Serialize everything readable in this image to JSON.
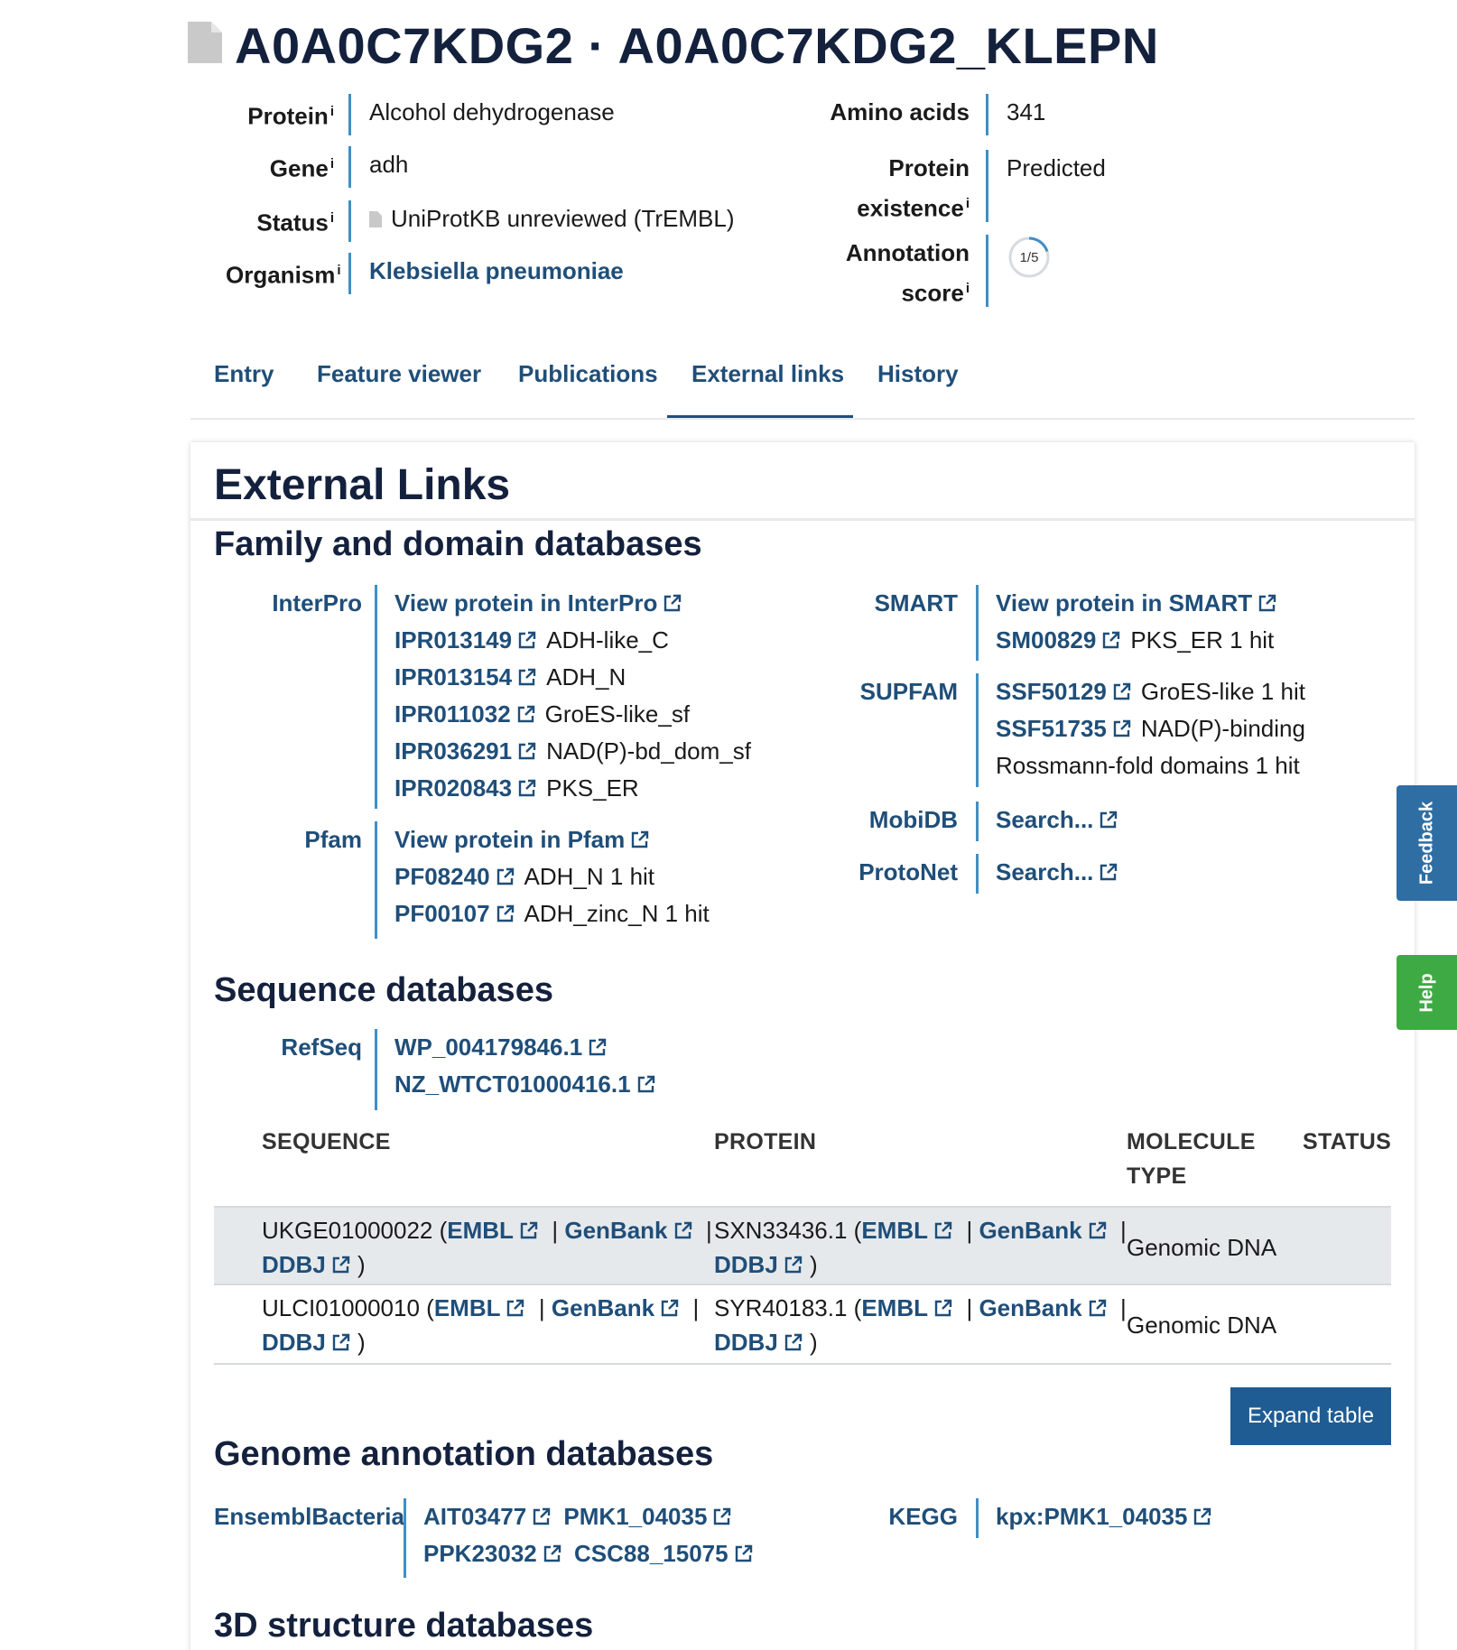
{
  "header": {
    "title": "A0A0C7KDG2 · A0A0C7KDG2_KLEPN"
  },
  "summary": {
    "left": [
      {
        "label": "Protein",
        "value": "Alcohol dehydrogenase"
      },
      {
        "label": "Gene",
        "value": "adh"
      },
      {
        "label": "Status",
        "value": "UniProtKB unreviewed (TrEMBL)"
      },
      {
        "label": "Organism",
        "value": "Klebsiella pneumoniae"
      }
    ],
    "info_marker": "i",
    "amino_acids_label": "Amino acids",
    "amino_acids_value": "341",
    "existence_label_1": "Protein",
    "existence_label_2": "existence",
    "existence_value": "Predicted",
    "annotation_label_1": "Annotation",
    "annotation_label_2": "score",
    "annotation_score": "1/5",
    "annotation_score_fraction": 0.2
  },
  "tabs": [
    "Entry",
    "Feature viewer",
    "Publications",
    "External links",
    "History"
  ],
  "active_tab": "External links",
  "card": {
    "title": "External Links",
    "family_section": "Family and domain databases",
    "sequence_section": "Sequence databases",
    "genome_section": "Genome annotation databases",
    "structure_section": "3D structure databases"
  },
  "family_dbs": {
    "interpro": {
      "label": "InterPro",
      "view": "View protein in InterPro",
      "items": [
        {
          "id": "IPR013149",
          "desc": "ADH-like_C"
        },
        {
          "id": "IPR013154",
          "desc": "ADH_N"
        },
        {
          "id": "IPR011032",
          "desc": "GroES-like_sf"
        },
        {
          "id": "IPR036291",
          "desc": "NAD(P)-bd_dom_sf"
        },
        {
          "id": "IPR020843",
          "desc": "PKS_ER"
        }
      ]
    },
    "pfam": {
      "label": "Pfam",
      "view": "View protein in Pfam",
      "items": [
        {
          "id": "PF08240",
          "desc": "ADH_N 1 hit"
        },
        {
          "id": "PF00107",
          "desc": "ADH_zinc_N 1 hit"
        }
      ]
    },
    "smart": {
      "label": "SMART",
      "view": "View protein in SMART",
      "items": [
        {
          "id": "SM00829",
          "desc": "PKS_ER 1 hit"
        }
      ]
    },
    "supfam": {
      "label": "SUPFAM",
      "items": [
        {
          "id": "SSF50129",
          "desc": "GroES-like 1 hit"
        },
        {
          "id": "SSF51735",
          "desc": "NAD(P)-binding"
        }
      ],
      "continuation": "Rossmann-fold domains 1 hit"
    },
    "mobidb": {
      "label": "MobiDB",
      "link": "Search..."
    },
    "protonet": {
      "label": "ProtoNet",
      "link": "Search..."
    }
  },
  "sequence_dbs": {
    "refseq": {
      "label": "RefSeq",
      "items": [
        "WP_004179846.1",
        "NZ_WTCT01000416.1"
      ]
    },
    "table": {
      "headers": {
        "sequence": "SEQUENCE",
        "protein": "PROTEIN",
        "molecule_type_1": "MOLECULE",
        "molecule_type_2": "TYPE",
        "status": "STATUS"
      },
      "links": {
        "embl": "EMBL",
        "genbank": "GenBank",
        "ddbj": "DDBJ"
      },
      "rows": [
        {
          "sequence": "UKGE01000022",
          "protein": "SXN33436.1",
          "molecule_type": "Genomic DNA",
          "status": ""
        },
        {
          "sequence": "ULCI01000010",
          "protein": "SYR40183.1",
          "molecule_type": "Genomic DNA",
          "status": ""
        }
      ],
      "expand_label": "Expand table"
    }
  },
  "genome_dbs": {
    "ensembl": {
      "label": "EnsemblBacteria",
      "items": [
        "AIT03477",
        "PMK1_04035",
        "PPK23032",
        "CSC88_15075"
      ]
    },
    "kegg": {
      "label": "KEGG",
      "items": [
        "kpx:PMK1_04035"
      ]
    }
  },
  "side": {
    "feedback": "Feedback",
    "help": "Help"
  },
  "colors": {
    "link": "#1f4e79",
    "bar": "#3f8fc6",
    "feedback": "#2f6ea3",
    "help": "#3eaa43"
  }
}
